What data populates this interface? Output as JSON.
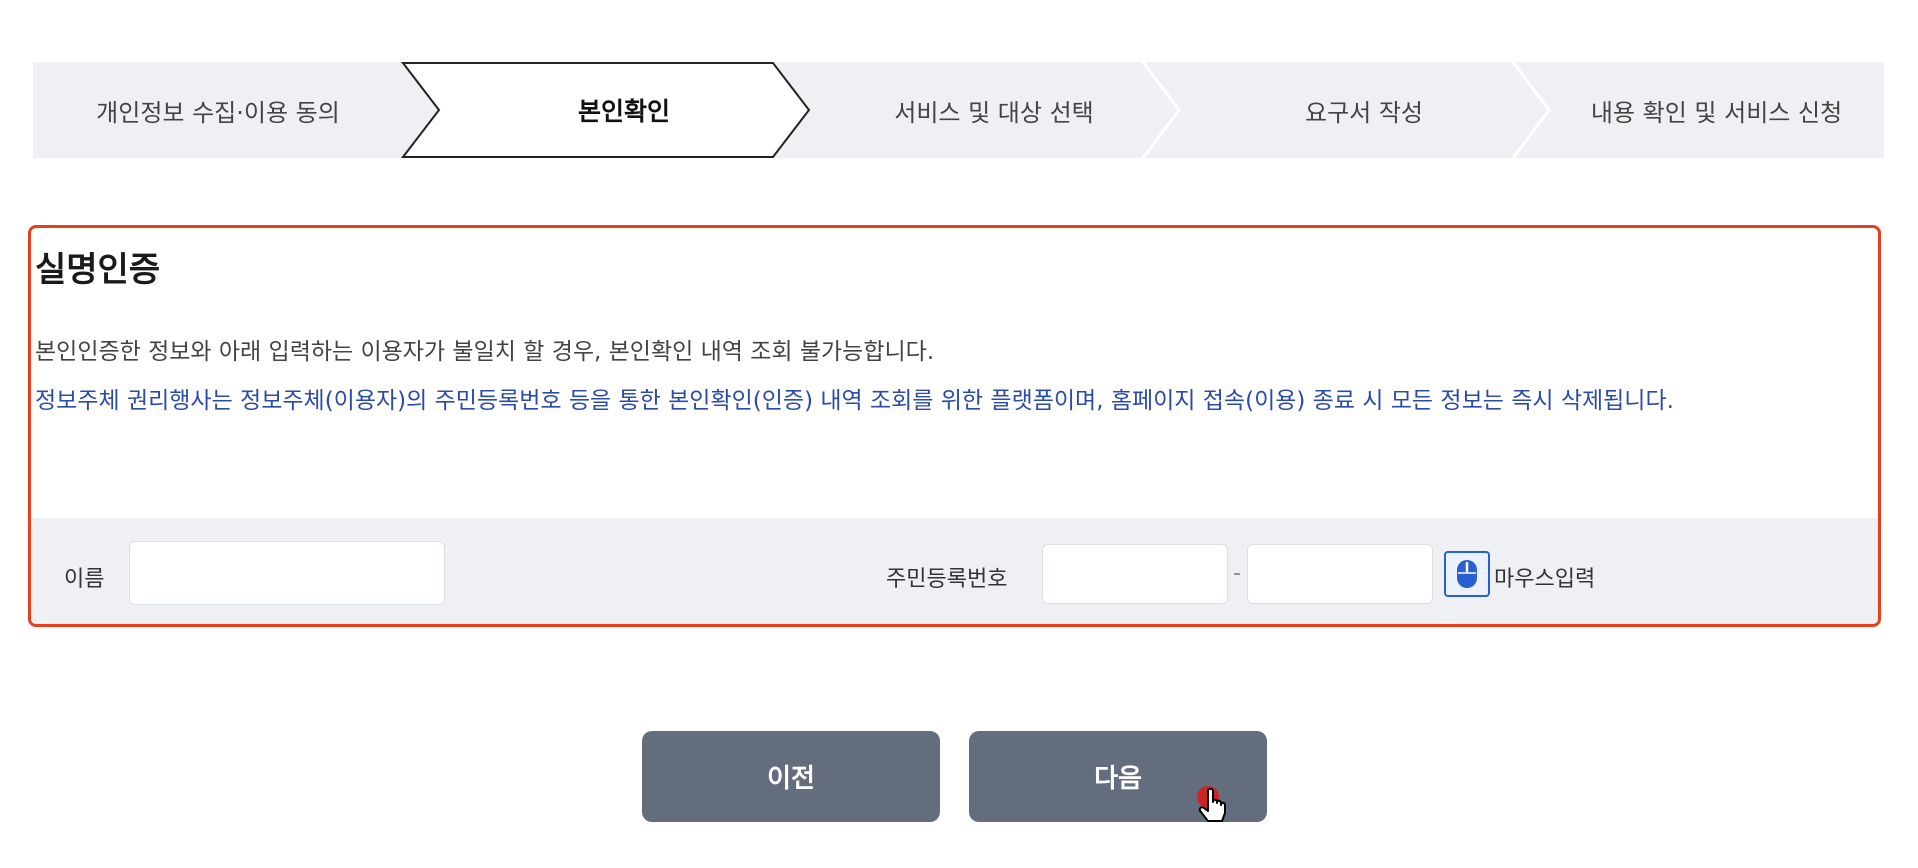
{
  "steps": [
    {
      "label": "개인정보 수집·이용 동의",
      "active": false
    },
    {
      "label": "본인확인",
      "active": true
    },
    {
      "label": "서비스 및 대상 선택",
      "active": false
    },
    {
      "label": "요구서 작성",
      "active": false
    },
    {
      "label": "내용 확인 및 서비스 신청",
      "active": false
    }
  ],
  "auth": {
    "title": "실명인증",
    "notice": "본인인증한 정보와 아래 입력하는 이용자가 불일치 할 경우, 본인확인 내역 조회 불가능합니다.",
    "notice_blue": "정보주체 권리행사는 정보주체(이용자)의 주민등록번호 등을 통한 본인확인(인증) 내역 조회를 위한 플랫폼이며, 홈페이지 접속(이용) 종료 시 모든 정보는 즉시 삭제됩니다.",
    "name_label": "이름",
    "name_value": "",
    "rrn_label": "주민등록번호",
    "rrn_front_value": "",
    "rrn_dash": "-",
    "rrn_back_value": "",
    "mouse_input_label": "마우스입력",
    "mouse_icon": "mouse-icon"
  },
  "buttons": {
    "prev_label": "이전",
    "next_label": "다음"
  },
  "colors": {
    "accent_border": "#e8401c",
    "notice_blue": "#2b4ba8",
    "button_bg": "#646d7d",
    "step_bg": "#eef0f3"
  }
}
